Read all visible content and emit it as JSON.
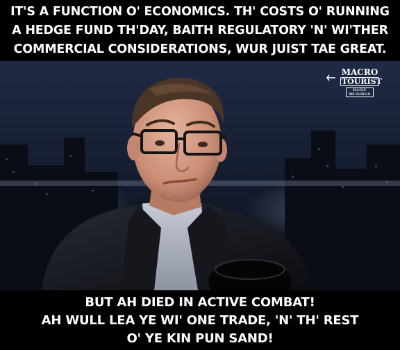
{
  "caption_top": {
    "lines": [
      "IT'S A FUNCTION O' ECONOMICS.  TH' COSTS O' RUNNING",
      "A HEDGE FUND TH'DAY, BAITH REGULATORY 'N' WI'THER",
      "COMMERCIAL CONSIDERATIONS, WUR JUIST TAE GREAT."
    ]
  },
  "caption_bottom": {
    "lines": [
      "BUT AH DIED IN ACTIVE COMBAT!",
      "AH WULL LEA YE WI' ONE TRADE, 'N' TH' REST",
      "O' YE KIN PUN SAND!"
    ]
  },
  "logo": {
    "line1": "MACRO",
    "line2": "TOURIST",
    "line3": "DAILY MUSINGS"
  },
  "colors": {
    "caption_background": "#000000",
    "caption_text": "#ffffff",
    "scene_sky": "#1d2740",
    "suit": "#1b1d22",
    "skin": "#d9a48d"
  }
}
